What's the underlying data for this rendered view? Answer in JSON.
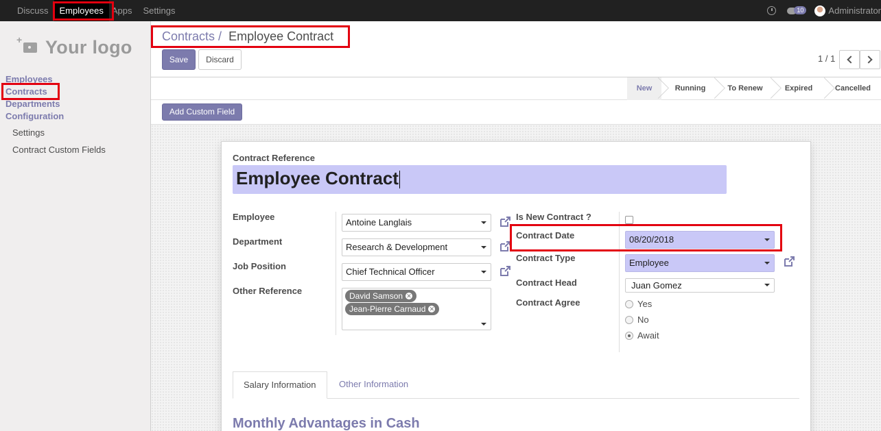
{
  "topbar": {
    "menu": [
      "Discuss",
      "Employees",
      "Apps",
      "Settings"
    ],
    "active_menu": "Employees",
    "message_count": "10",
    "user_name": "Administrator"
  },
  "sidebar": {
    "logo_text": "Your logo",
    "links": [
      "Employees",
      "Contracts",
      "Departments",
      "Configuration"
    ],
    "config_items": [
      "Settings",
      "Contract Custom Fields"
    ]
  },
  "breadcrumb": {
    "parent": "Contracts",
    "separator": "/",
    "current": "Employee Contract"
  },
  "buttons": {
    "save": "Save",
    "discard": "Discard",
    "add_custom_field": "Add Custom Field"
  },
  "pager": {
    "text": "1 / 1"
  },
  "stages": [
    "New",
    "Running",
    "To Renew",
    "Expired",
    "Cancelled"
  ],
  "active_stage": "New",
  "form": {
    "contract_reference_label": "Contract Reference",
    "contract_reference_value": "Employee Contract",
    "employee_label": "Employee",
    "employee_value": "Antoine Langlais",
    "department_label": "Department",
    "department_value": "Research & Development",
    "job_position_label": "Job Position",
    "job_position_value": "Chief Technical Officer",
    "other_reference_label": "Other Reference",
    "other_reference_tags": [
      "David Samson",
      "Jean-Pierre Carnaud"
    ],
    "is_new_contract_label": "Is New Contract ?",
    "contract_date_label": "Contract Date",
    "contract_date_value": "08/20/2018",
    "contract_type_label": "Contract Type",
    "contract_type_value": "Employee",
    "contract_head_label": "Contract Head",
    "contract_head_value": "Juan Gomez",
    "contract_agree_label": "Contract Agree",
    "contract_agree_options": [
      "Yes",
      "No",
      "Await"
    ],
    "contract_agree_selected": "Await"
  },
  "tabs": [
    "Salary Information",
    "Other Information"
  ],
  "section_title": "Monthly Advantages in Cash",
  "colors": {
    "accent": "#7c7bad",
    "highlight": "#e3000f",
    "field_fill": "#c9c8f7"
  }
}
